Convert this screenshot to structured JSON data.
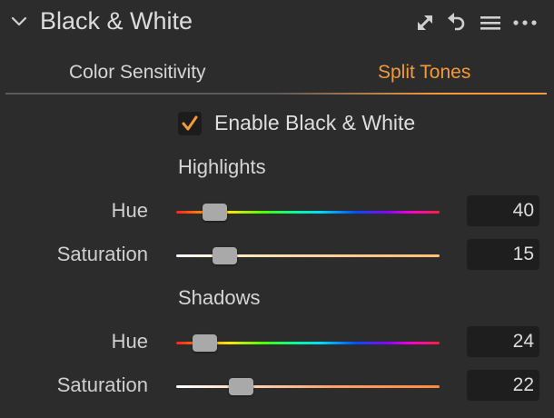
{
  "header": {
    "title": "Black & White",
    "icons": {
      "collapse": "chevron-down-icon",
      "expand": "expand-arrows-icon",
      "reset": "reset-undo-icon",
      "presets": "menu-lines-icon",
      "more": "more-dots-icon"
    }
  },
  "tabs": [
    {
      "label": "Color Sensitivity",
      "active": false
    },
    {
      "label": "Split Tones",
      "active": true
    }
  ],
  "enable": {
    "label": "Enable Black & White",
    "checked": true
  },
  "highlights": {
    "title": "Highlights",
    "hue": {
      "label": "Hue",
      "value": "40"
    },
    "saturation": {
      "label": "Saturation",
      "value": "15"
    }
  },
  "shadows": {
    "title": "Shadows",
    "hue": {
      "label": "Hue",
      "value": "24"
    },
    "saturation": {
      "label": "Saturation",
      "value": "22"
    }
  },
  "colors": {
    "accent": "#f39a3a",
    "background": "#2c2c2c",
    "field": "#1e1e1e"
  }
}
